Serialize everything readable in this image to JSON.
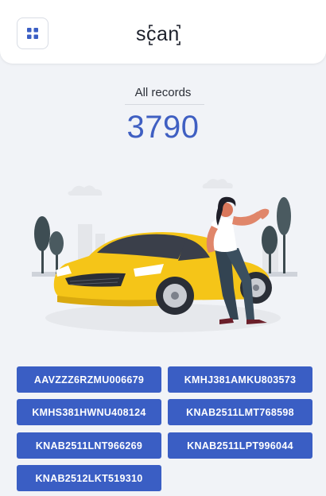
{
  "header": {
    "logo_text": "scan",
    "menu_icon": "grid-icon"
  },
  "summary": {
    "label": "All records",
    "count": "3790"
  },
  "illustration": {
    "description_icon": "woman-leaning-on-yellow-car-illustration"
  },
  "records": [
    "AAVZZZ6RZMU006679",
    "KMHJ381AMKU803573",
    "KMHS381HWNU408124",
    "KNAB2511LMT768598",
    "KNAB2511LNT966269",
    "KNAB2511LPT996044",
    "KNAB2512LKT519310"
  ],
  "colors": {
    "accent": "#3a5ec4",
    "count": "#3f5fc2",
    "car": "#f5c518",
    "background": "#f1f3f7"
  }
}
